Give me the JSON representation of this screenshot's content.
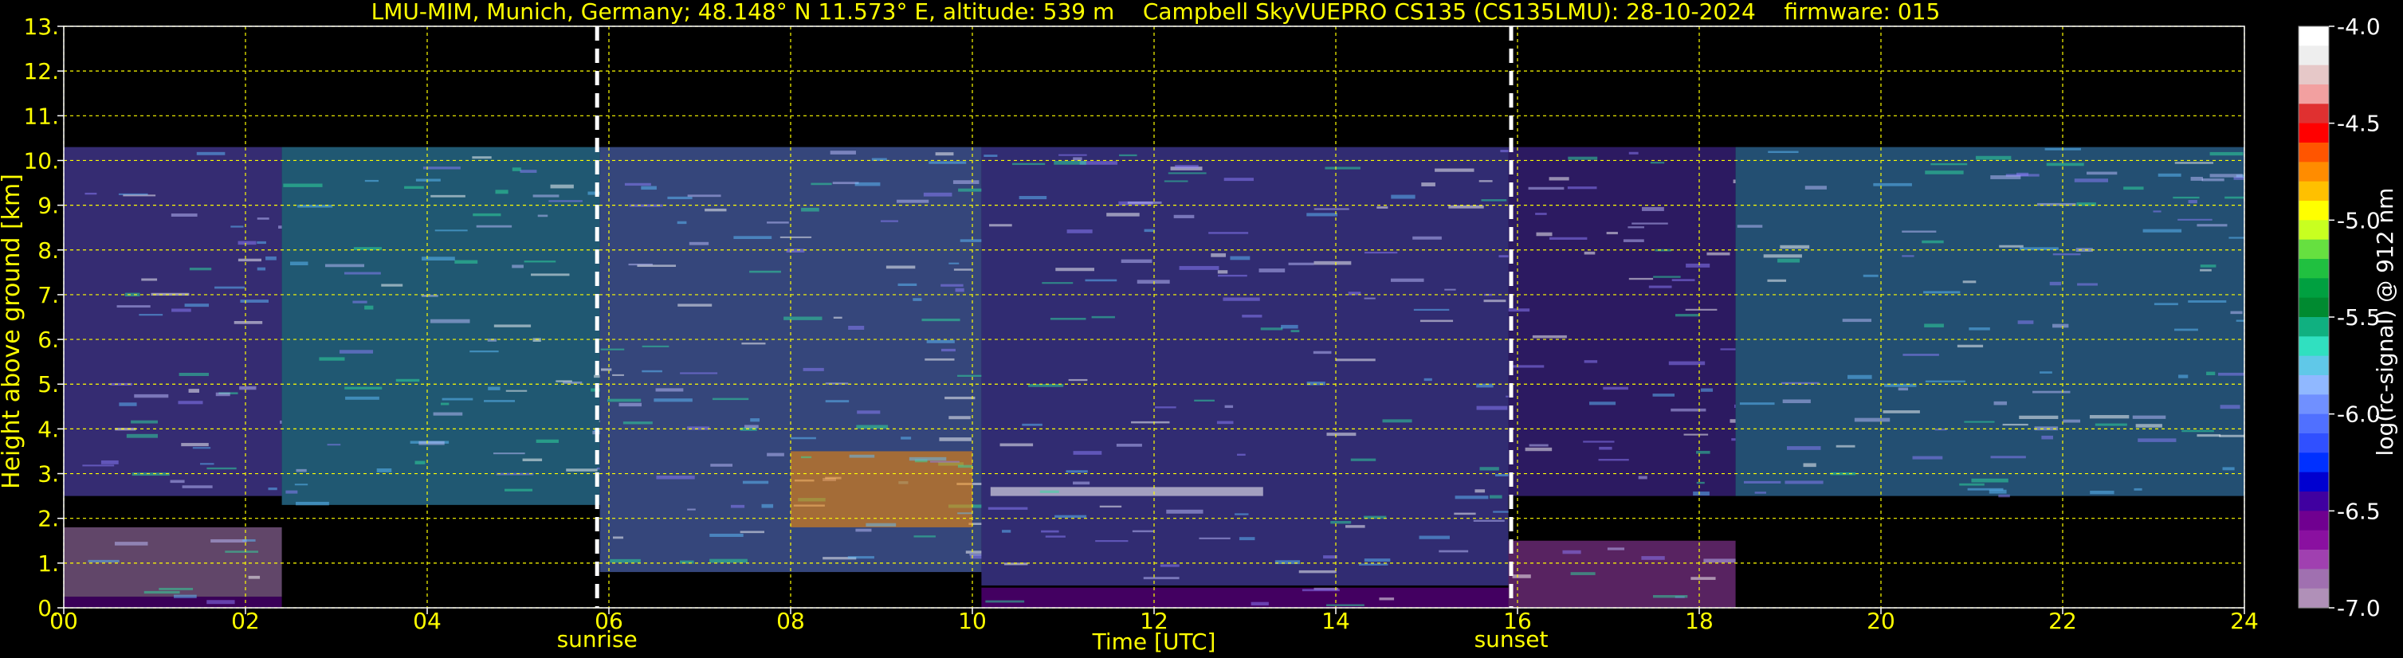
{
  "chart_data": {
    "type": "heatmap",
    "title": "LMU-MIM, Munich, Germany; 48.148° N 11.573° E, altitude: 539 m    Campbell SkyVUEPRO CS135 (CS135LMU): 28-10-2024    firmware: 015",
    "xlabel": "Time [UTC]",
    "ylabel": "Height above ground [km]",
    "xlim": [
      0,
      24
    ],
    "ylim": [
      0,
      13
    ],
    "x_ticks": [
      "00",
      "02",
      "04",
      "06",
      "08",
      "10",
      "12",
      "14",
      "16",
      "18",
      "20",
      "22",
      "24"
    ],
    "y_ticks": [
      "0.",
      "1.",
      "2.",
      "3.",
      "4.",
      "5.",
      "6.",
      "7.",
      "8.",
      "9.",
      "10.",
      "11.",
      "12.",
      "13."
    ],
    "grid": true,
    "grid_color": "#ffff00",
    "background": "#000000",
    "markers": [
      {
        "x": 5.87,
        "label": "sunrise",
        "color": "#ffffff"
      },
      {
        "x": 15.93,
        "label": "sunset",
        "color": "#ffffff"
      }
    ],
    "colorbar": {
      "label": "log(rc-signal) @ 912 nm",
      "ticks": [
        "-4.0",
        "-4.5",
        "-5.0",
        "-5.5",
        "-6.0",
        "-6.5",
        "-7.0"
      ],
      "range": [
        -7.0,
        -4.0
      ],
      "colors": [
        "#ffffff",
        "#eeeeee",
        "#e6c8c8",
        "#f2a0a0",
        "#e03030",
        "#ff0000",
        "#ff5500",
        "#ff8c00",
        "#ffc000",
        "#ffff00",
        "#c8ff20",
        "#66e040",
        "#20c040",
        "#00a040",
        "#008a30",
        "#10b080",
        "#30e0c0",
        "#60c8e8",
        "#90b8ff",
        "#7090ff",
        "#5070ff",
        "#3050ff",
        "#0030ff",
        "#0000d0",
        "#4000a0",
        "#700090",
        "#8a10a0",
        "#a040b0",
        "#a070b0",
        "#b090b8"
      ]
    },
    "regions": [
      {
        "x": [
          0.0,
          2.4
        ],
        "y": [
          0.0,
          0.25
        ],
        "level": -6.6,
        "color": "#6a00a0"
      },
      {
        "x": [
          0.0,
          2.4
        ],
        "y": [
          0.25,
          1.8
        ],
        "level": -6.9,
        "color": "#b080c0"
      },
      {
        "x": [
          0.0,
          2.4
        ],
        "y": [
          2.5,
          10.3
        ],
        "level": -6.4,
        "color": "#6050d0"
      },
      {
        "x": [
          2.4,
          5.9
        ],
        "y": [
          2.3,
          10.3
        ],
        "level": -6.0,
        "color": "#3aa0d0"
      },
      {
        "x": [
          5.9,
          10.1
        ],
        "y": [
          0.8,
          10.3
        ],
        "level": -5.8,
        "color": "#6080e0"
      },
      {
        "x": [
          8.0,
          10.0
        ],
        "y": [
          1.8,
          3.5
        ],
        "level": -5.2,
        "color": "#ff8c00"
      },
      {
        "x": [
          10.1,
          15.9
        ],
        "y": [
          0.0,
          0.45
        ],
        "level": -6.6,
        "color": "#7a00b0"
      },
      {
        "x": [
          10.1,
          15.9
        ],
        "y": [
          0.5,
          10.3
        ],
        "level": -6.3,
        "color": "#5a50d0"
      },
      {
        "x": [
          15.9,
          18.4
        ],
        "y": [
          0.0,
          1.5
        ],
        "level": -6.8,
        "color": "#a040b0"
      },
      {
        "x": [
          15.9,
          18.4
        ],
        "y": [
          2.5,
          10.3
        ],
        "level": -6.5,
        "color": "#5030b0"
      },
      {
        "x": [
          18.4,
          24.0
        ],
        "y": [
          2.5,
          10.3
        ],
        "level": -5.9,
        "color": "#4090d0"
      },
      {
        "x": [
          10.2,
          13.2
        ],
        "y": [
          2.5,
          2.7
        ],
        "level": -4.0,
        "color": "#ffffff"
      }
    ]
  }
}
